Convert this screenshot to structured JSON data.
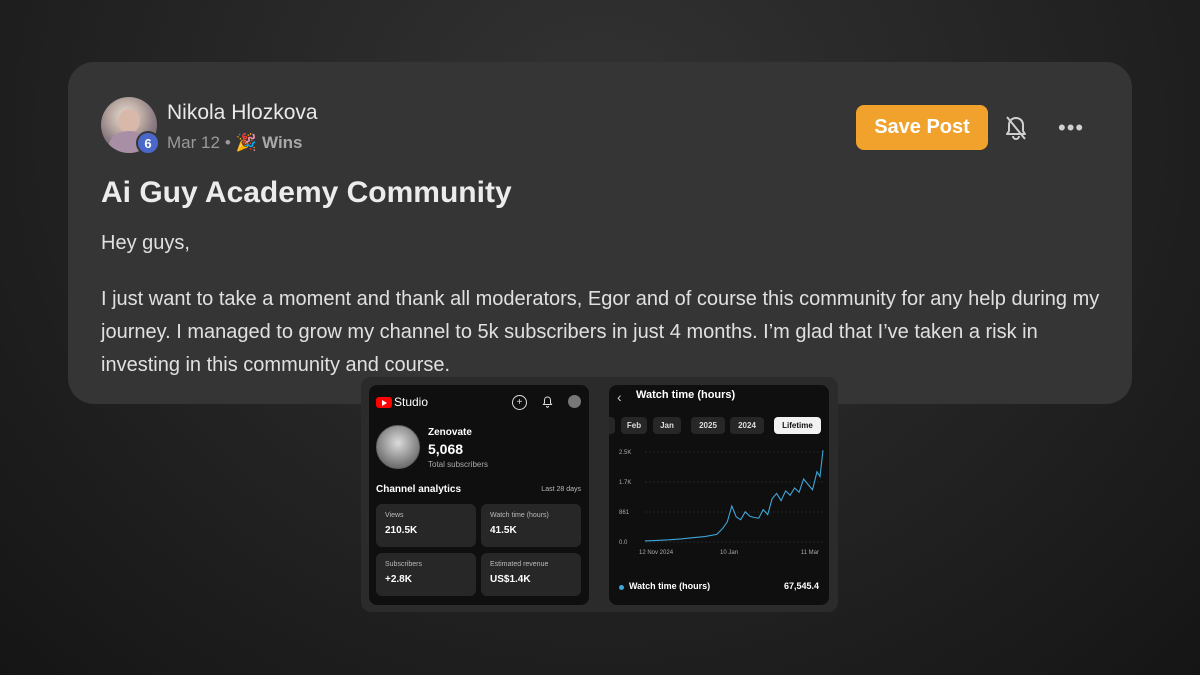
{
  "post": {
    "author": "Nikola Hlozkova",
    "level": "6",
    "date": "Mar 12",
    "separator": "•",
    "category_emoji": "🎉",
    "category": "Wins",
    "save_label": "Save Post",
    "more_label": "•••",
    "title": "Ai Guy Academy Community",
    "greeting": "Hey guys,",
    "body": "I just want to take a moment and thank all moderators, Egor and of course this community for any help during my journey. I managed to grow my channel to 5k subscribers in just 4 months. I’m glad that I’ve taken a risk in investing in this community and course."
  },
  "studio": {
    "app_name": "Studio",
    "channel_name": "Zenovate",
    "subscriber_count": "5,068",
    "subscriber_label": "Total subscribers",
    "analytics_title": "Channel analytics",
    "analytics_range": "Last 28 days",
    "tiles": [
      {
        "label": "Views",
        "value": "210.5K"
      },
      {
        "label": "Watch time (hours)",
        "value": "41.5K"
      },
      {
        "label": "Subscribers",
        "value": "+2.8K"
      },
      {
        "label": "Estimated revenue",
        "value": "US$1.4K"
      }
    ]
  },
  "watch": {
    "back_icon": "‹",
    "title": "Watch time (hours)",
    "tabs": [
      "Feb",
      "Jan",
      "2025",
      "2024",
      "Lifetime"
    ],
    "active_tab": "Lifetime",
    "legend_label": "Watch time (hours)",
    "total": "67,545.4"
  },
  "chart_data": {
    "type": "line",
    "y_ticks": [
      "2.5K",
      "1.7K",
      "861",
      "0.0"
    ],
    "x_ticks": [
      "12 Nov 2024",
      "10 Jan",
      "11 Mar"
    ],
    "ylim": [
      0,
      2500
    ],
    "series": [
      {
        "name": "Watch time (hours)",
        "color": "#3ea6d8",
        "x": [
          "2024-11-12",
          "2024-11-20",
          "2024-11-28",
          "2024-12-06",
          "2024-12-14",
          "2024-12-22",
          "2024-12-30",
          "2025-01-03",
          "2025-01-06",
          "2025-01-09",
          "2025-01-12",
          "2025-01-15",
          "2025-01-18",
          "2025-01-21",
          "2025-01-24",
          "2025-01-27",
          "2025-01-30",
          "2025-02-02",
          "2025-02-05",
          "2025-02-08",
          "2025-02-11",
          "2025-02-14",
          "2025-02-17",
          "2025-02-20",
          "2025-02-23",
          "2025-02-26",
          "2025-03-01",
          "2025-03-04",
          "2025-03-07",
          "2025-03-09",
          "2025-03-11"
        ],
        "values": [
          30,
          45,
          60,
          85,
          120,
          150,
          210,
          380,
          560,
          1000,
          700,
          620,
          840,
          720,
          680,
          660,
          900,
          760,
          1200,
          1350,
          1150,
          1420,
          1300,
          1500,
          1380,
          1750,
          1600,
          1450,
          1950,
          1820,
          2550
        ]
      }
    ]
  }
}
